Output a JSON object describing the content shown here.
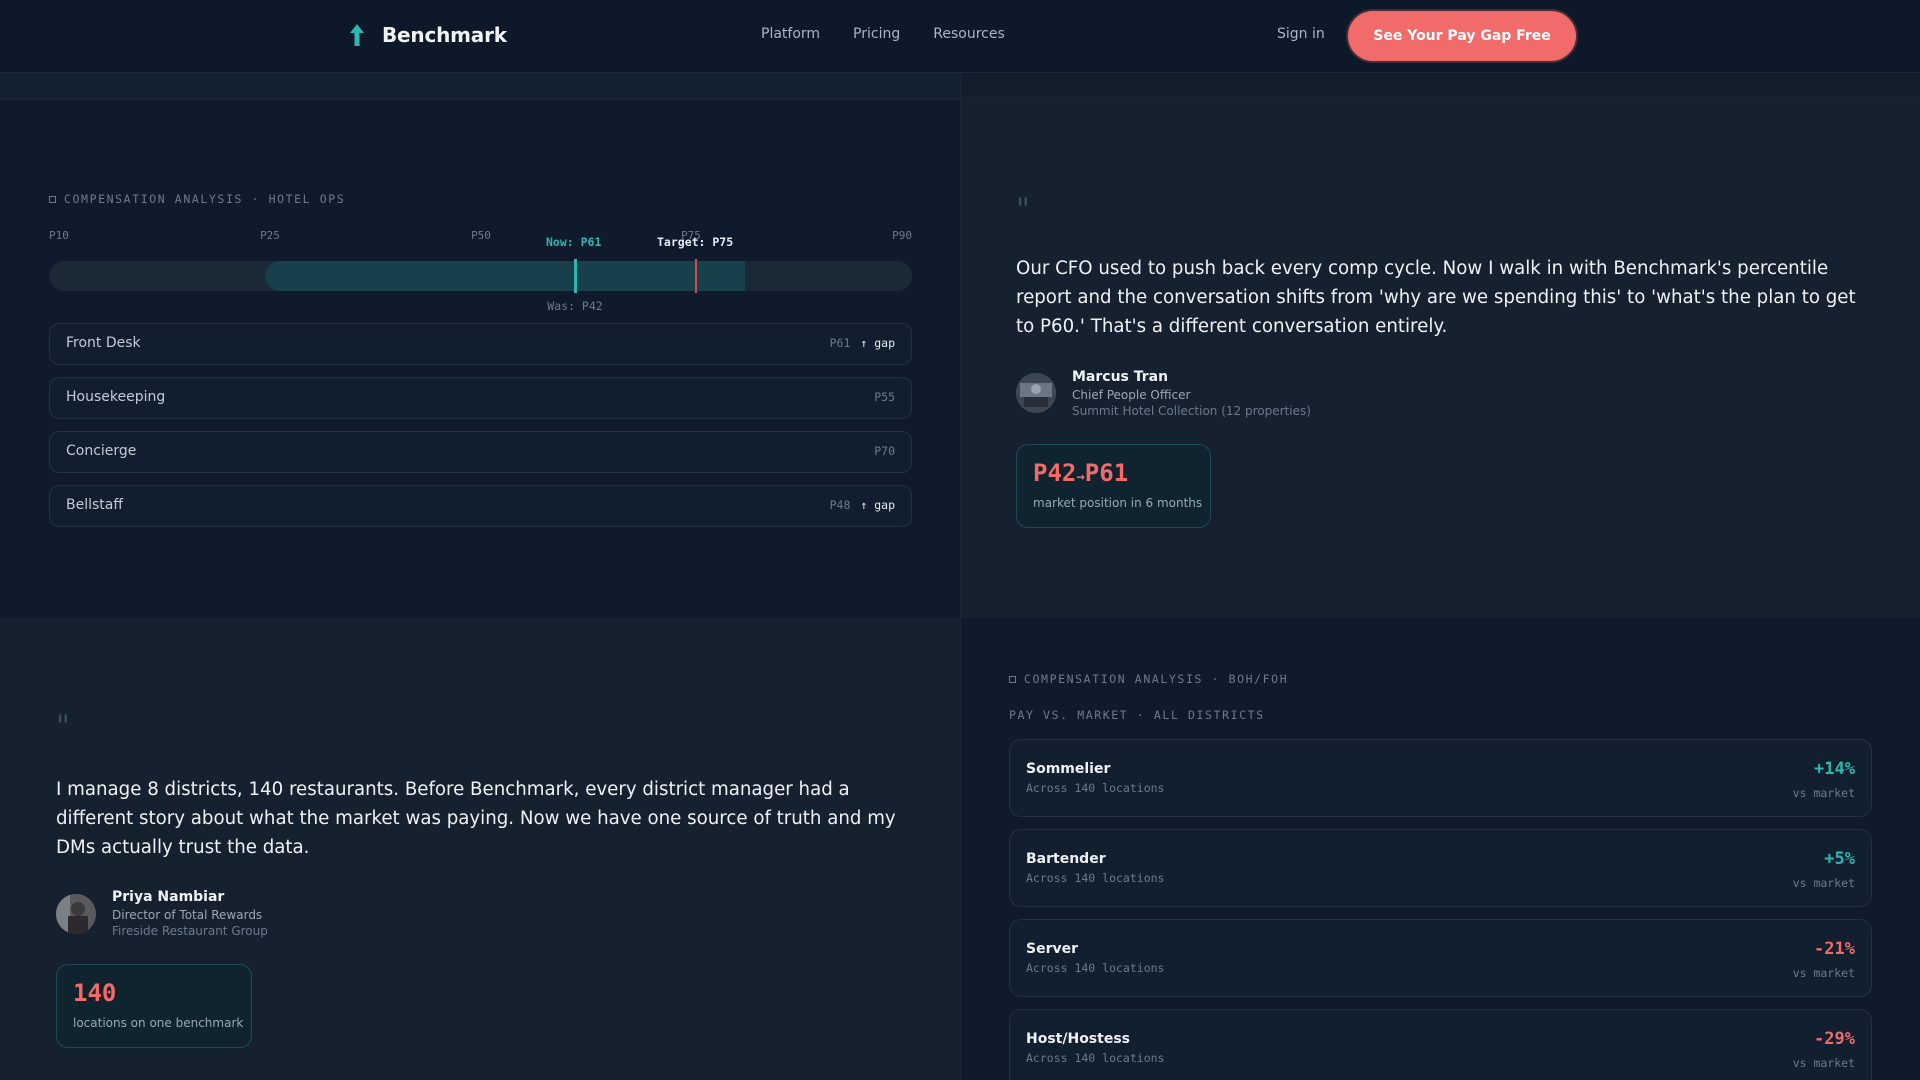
{
  "colors": {
    "accent": "#f26b6b",
    "teal": "#2ab8b0",
    "background": "#0f1b2b",
    "positive": "#2ab8b0",
    "negative": "#f26b6b"
  },
  "nav": {
    "brand": "Benchmark",
    "logo_icon": "arrow-up-icon",
    "links": [
      "Platform",
      "Pricing",
      "Resources"
    ],
    "signin": "Sign in",
    "cta": "See Your Pay Gap Free"
  },
  "hotel": {
    "section_label": "COMPENSATION ANALYSIS · HOTEL OPS",
    "ticks": [
      "P10",
      "P25",
      "P50",
      "P75",
      "P90"
    ],
    "now_label": "Now: P61",
    "target_label": "Target: P75",
    "was_label": "Was: P42",
    "was_percentile": 42,
    "now_percentile": 61,
    "target_percentile": 75,
    "roles": [
      {
        "name": "Front Desk",
        "percentile": "P61",
        "gap": "↑ gap"
      },
      {
        "name": "Housekeeping",
        "percentile": "P55",
        "gap": ""
      },
      {
        "name": "Concierge",
        "percentile": "P70",
        "gap": ""
      },
      {
        "name": "Bellstaff",
        "percentile": "P48",
        "gap": "↑ gap"
      }
    ]
  },
  "testimonial_1": {
    "quote_mark": "\"",
    "quote": "Our CFO used to push back every comp cycle. Now I walk in with Benchmark's percentile report and the conversation shifts from 'why are we spending this' to 'what's the plan to get to P60.' That's a different conversation entirely.",
    "name": "Marcus Tran",
    "title": "Chief People Officer",
    "company": "Summit Hotel Collection (12 properties)",
    "stat_value_from": "P42",
    "stat_arrow": "→",
    "stat_value_to": "P61",
    "stat_label": "market position in 6 months"
  },
  "testimonial_2": {
    "quote_mark": "\"",
    "quote": "I manage 8 districts, 140 restaurants. Before Benchmark, every district manager had a different story about what the market was paying. Now we have one source of truth and my DMs actually trust the data.",
    "name": "Priya Nambiar",
    "title": "Director of Total Rewards",
    "company": "Fireside Restaurant Group",
    "stat_value": "140",
    "stat_label": "locations on one benchmark"
  },
  "boh": {
    "section_label": "COMPENSATION ANALYSIS · BOH/FOH",
    "sub_label": "PAY VS. MARKET · ALL DISTRICTS",
    "vs_label": "vs market",
    "rows": [
      {
        "name": "Sommelier",
        "sub": "Across 140 locations",
        "value": "+14%",
        "positive": true
      },
      {
        "name": "Bartender",
        "sub": "Across 140 locations",
        "value": "+5%",
        "positive": true
      },
      {
        "name": "Server",
        "sub": "Across 140 locations",
        "value": "-21%",
        "positive": false
      },
      {
        "name": "Host/Hostess",
        "sub": "Across 140 locations",
        "value": "-29%",
        "positive": false
      }
    ]
  }
}
